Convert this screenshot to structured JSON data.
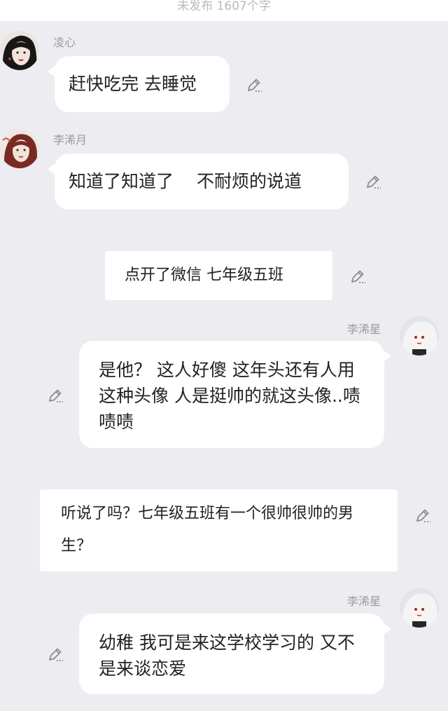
{
  "header": {
    "status_text": "未发布 1607个字"
  },
  "messages": [
    {
      "speaker": "凌心",
      "text": "赶快吃完 去睡觉"
    },
    {
      "speaker": "李浠月",
      "text": "知道了知道了　 不耐烦的说道"
    },
    {
      "text": "点开了微信 七年级五班"
    },
    {
      "speaker": "李浠星",
      "text": "是他？ 这人好傻 这年头还有人用这种头像 人是挺帅的就这头像..啧啧啧"
    },
    {
      "text": "听说了吗？七年级五班有一个很帅很帅的男生？"
    },
    {
      "speaker": "李浠星",
      "text": "幼稚 我可是来这学校学习的 又不是来谈恋爱"
    }
  ],
  "icons": {
    "edit": "edit-pencil-icon"
  },
  "colors": {
    "background": "#ececf1",
    "bubble": "#ffffff",
    "name": "#9a9aa2",
    "icon": "#8a8a92"
  }
}
